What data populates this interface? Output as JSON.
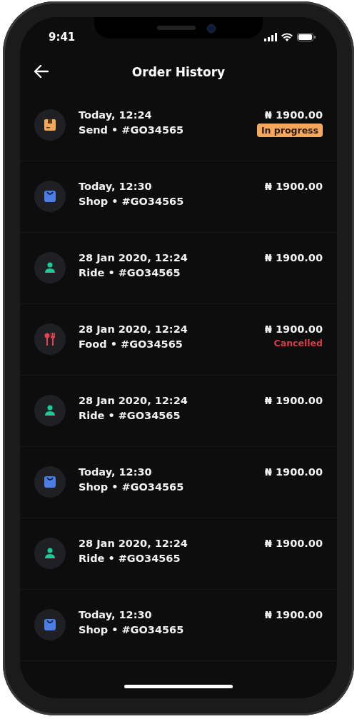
{
  "status_bar": {
    "time": "9:41"
  },
  "header": {
    "title": "Order History"
  },
  "orders": [
    {
      "kind": "send",
      "date": "Today, 12:24",
      "label": "Send • #GO34565",
      "amount": "₦ 1900.00",
      "status": {
        "kind": "badge",
        "label": "In progress"
      }
    },
    {
      "kind": "shop",
      "date": "Today, 12:30",
      "label": "Shop • #GO34565",
      "amount": "₦ 1900.00"
    },
    {
      "kind": "ride",
      "date": "28 Jan 2020, 12:24",
      "label": "Ride • #GO34565",
      "amount": "₦ 1900.00"
    },
    {
      "kind": "food",
      "date": "28 Jan 2020, 12:24",
      "label": "Food • #GO34565",
      "amount": "₦ 1900.00",
      "status": {
        "kind": "error",
        "label": "Cancelled"
      }
    },
    {
      "kind": "ride",
      "date": "28 Jan 2020, 12:24",
      "label": "Ride • #GO34565",
      "amount": "₦ 1900.00"
    },
    {
      "kind": "shop",
      "date": "Today, 12:30",
      "label": "Shop • #GO34565",
      "amount": "₦ 1900.00"
    },
    {
      "kind": "ride",
      "date": "28 Jan 2020, 12:24",
      "label": "Ride • #GO34565",
      "amount": "₦ 1900.00"
    },
    {
      "kind": "shop",
      "date": "Today, 12:30",
      "label": "Shop • #GO34565",
      "amount": "₦ 1900.00"
    }
  ]
}
